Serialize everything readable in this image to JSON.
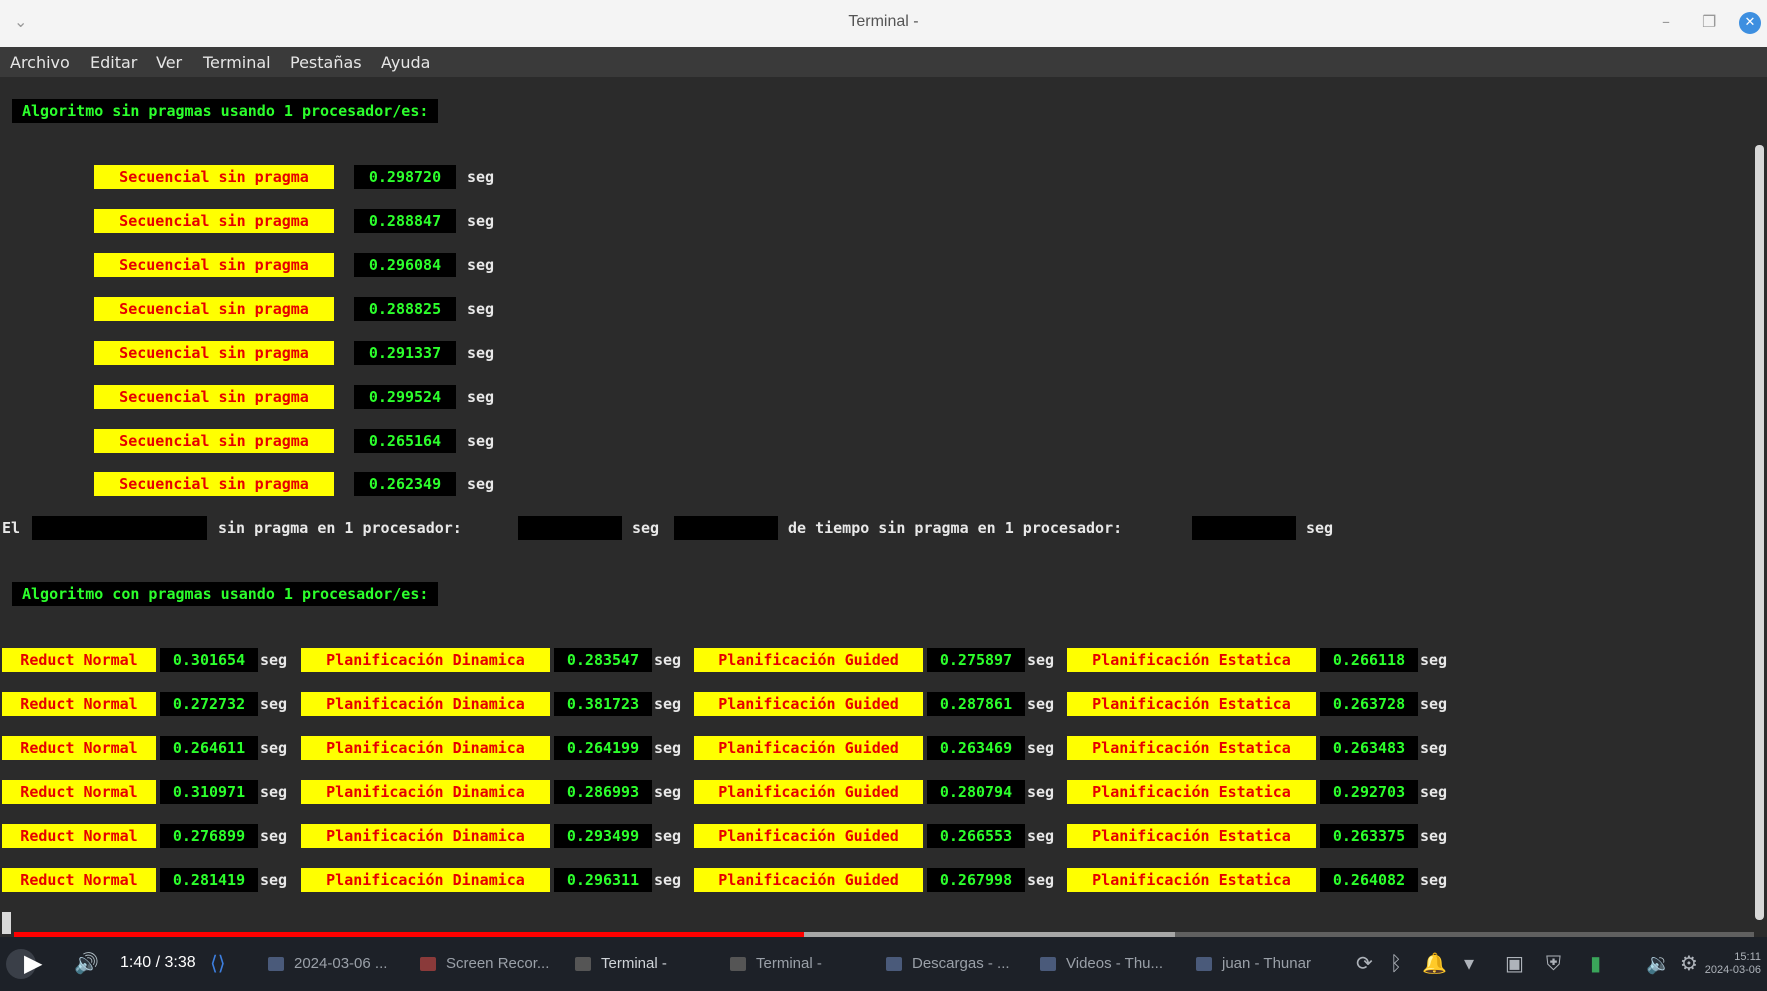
{
  "window": {
    "title": "Terminal -"
  },
  "menu": [
    "Archivo",
    "Editar",
    "Ver",
    "Terminal",
    "Pestañas",
    "Ayuda"
  ],
  "terminal": {
    "header1": "Algoritmo sin pragmas usando 1 procesador/es:",
    "seq_label": "Secuencial sin pragma",
    "unit": "seg",
    "seq_times": [
      "0.298720",
      "0.288847",
      "0.296084",
      "0.288825",
      "0.291337",
      "0.299524",
      "0.265164",
      "0.262349"
    ],
    "summary": {
      "prefix": "El",
      "middle": "sin pragma en 1 procesador:",
      "suffix": "de tiempo sin pragma en 1 procesador:"
    },
    "header2": "Algoritmo con pragmas usando 1 procesador/es:",
    "parallel_labels": [
      "Reduct Normal",
      "Planificación Dinamica",
      "Planificación Guided",
      "Planificación Estatica"
    ],
    "parallel_rows": [
      [
        "0.301654",
        "0.283547",
        "0.275897",
        "0.266118"
      ],
      [
        "0.272732",
        "0.381723",
        "0.287861",
        "0.263728"
      ],
      [
        "0.264611",
        "0.264199",
        "0.263469",
        "0.263483"
      ],
      [
        "0.310971",
        "0.286993",
        "0.280794",
        "0.292703"
      ],
      [
        "0.276899",
        "0.293499",
        "0.266553",
        "0.263375"
      ],
      [
        "0.281419",
        "0.296311",
        "0.267998",
        "0.264082"
      ]
    ]
  },
  "video": {
    "time": "1:40 / 3:38",
    "played_fraction": 0.454,
    "buffered_fraction": 0.667
  },
  "taskbar": {
    "tasks": [
      "2024-03-06 ...",
      "Screen Recor...",
      "Terminal -",
      "Terminal -",
      "Descargas - ...",
      "Videos - Thu...",
      "juan - Thunar"
    ],
    "clock_time": "15:11",
    "clock_date": "2024-03-06"
  },
  "colors": {
    "value_green": "#2cff2c",
    "label_yellow": "#ffff00",
    "label_red": "#e60000",
    "progress_red": "#ff0000"
  }
}
